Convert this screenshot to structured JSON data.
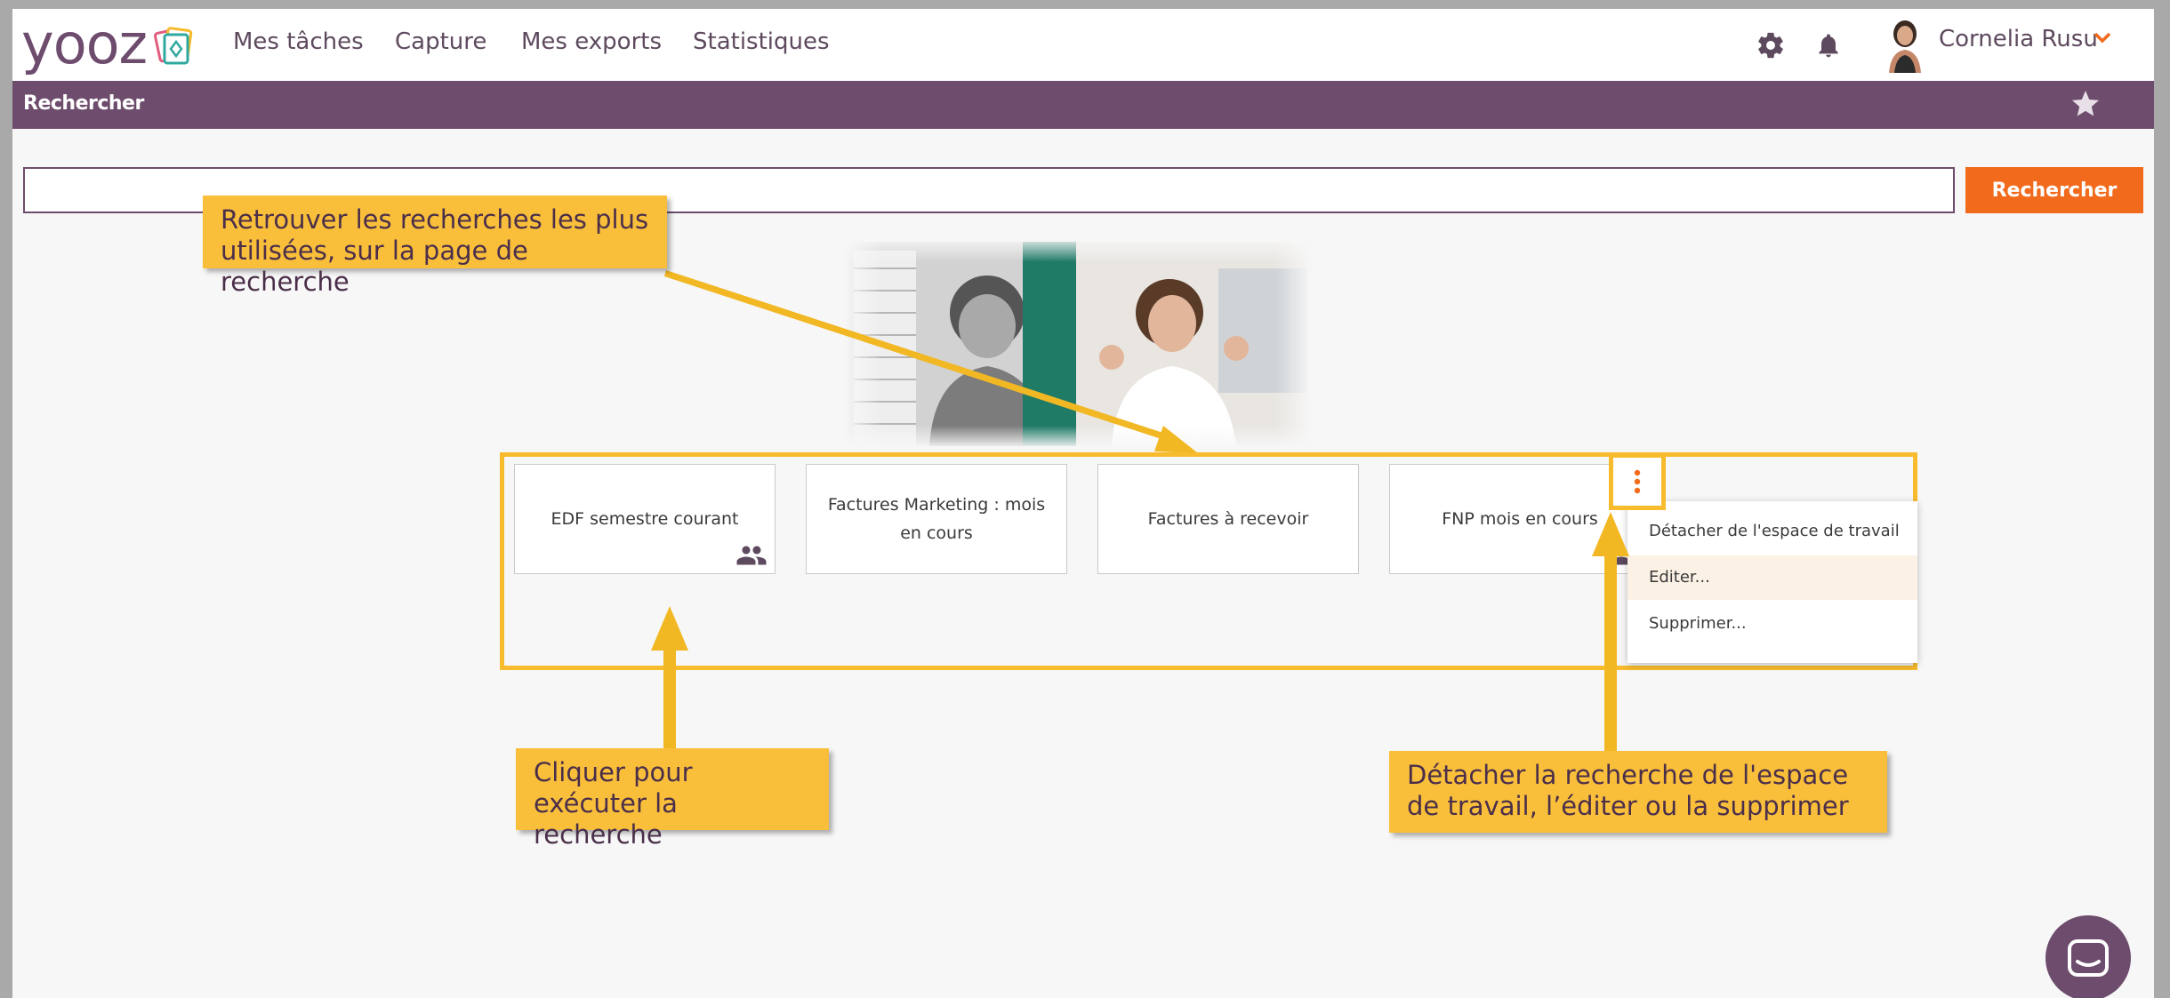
{
  "brand": {
    "logo_text": "yooz",
    "accent": "#6e4c6d",
    "highlight": "#f7bb2d",
    "button_color": "#f26b1d"
  },
  "nav": {
    "items": [
      "Mes tâches",
      "Capture",
      "Mes exports",
      "Statistiques"
    ],
    "icons": [
      "gear-icon",
      "bell-icon"
    ],
    "user_name": "Cornelia Rusu"
  },
  "subbar": {
    "title": "Rechercher"
  },
  "search": {
    "value": "",
    "button_label": "Rechercher"
  },
  "saved_searches": [
    {
      "label": "EDF semestre courant",
      "shared": true
    },
    {
      "label": "Factures Marketing : mois en cours",
      "shared": false
    },
    {
      "label": "Factures à recevoir",
      "shared": false
    },
    {
      "label": "FNP mois en cours",
      "shared": true
    }
  ],
  "card_menu": {
    "items": [
      "Détacher de l'espace de travail",
      "Editer...",
      "Supprimer..."
    ],
    "hovered_index": 1
  },
  "callouts": {
    "top": "Retrouver les recherches les plus utilisées, sur la page de recherche",
    "bottom_left": "Cliquer pour exécuter la recherche",
    "bottom_right": "Détacher la recherche de l'espace de travail, l’éditer ou la supprimer"
  }
}
